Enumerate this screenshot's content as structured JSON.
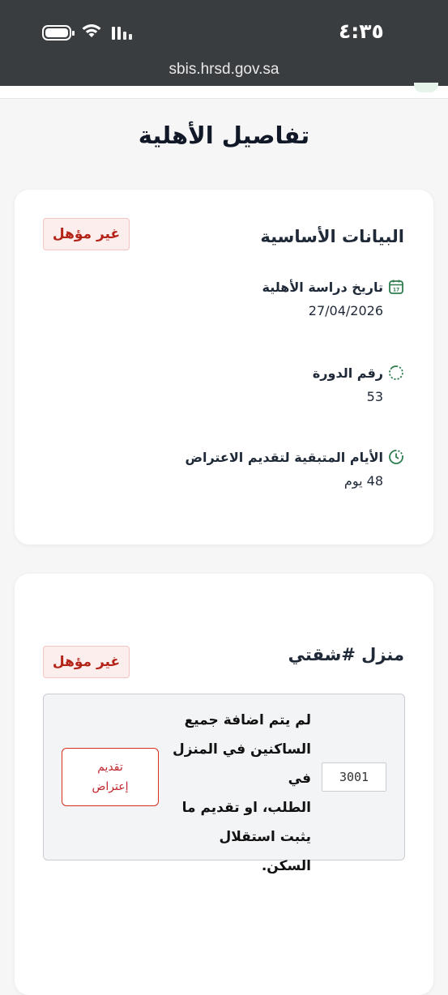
{
  "status_bar": {
    "time": "٤:٣٥",
    "url": "sbis.hrsd.gov.sa",
    "icons": [
      "battery-icon",
      "wifi-icon",
      "signal-icon"
    ]
  },
  "page": {
    "title": "تفاصيل الأهلية"
  },
  "basic_info": {
    "title": "البيانات الأساسية",
    "status_badge": "غير مؤهل",
    "fields": [
      {
        "label": "تاريخ دراسة الأهلية",
        "value": "27/04/2026",
        "icon": "calendar-icon"
      },
      {
        "label": "رقم الدورة",
        "value": "53",
        "icon": "cycle-icon"
      },
      {
        "label": "الأيام المتبقية لتقديم الاعتراض",
        "value": "48 يوم",
        "icon": "clock-icon"
      }
    ]
  },
  "housing": {
    "title": "منزل #شقتي",
    "status_badge": "غير مؤهل",
    "notice": {
      "code": "3001",
      "lines": [
        "لم يتم اضافة جميع",
        "الساكنين في المنزل في",
        "الطلب، او تقديم ما",
        "يثبت استقلال",
        "السكن."
      ],
      "appeal_line1": "تقديم",
      "appeal_line2": "إعتراض"
    }
  },
  "colors": {
    "header_bg": "#3a3d40",
    "badge_text": "#b42318",
    "badge_bg": "#fdeeee",
    "icon_green": "#2e7d4f",
    "appeal_red": "#c0262d"
  }
}
